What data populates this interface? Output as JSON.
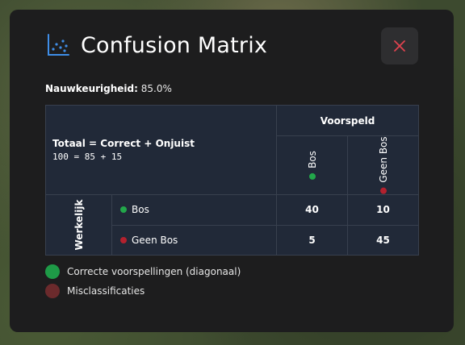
{
  "modal": {
    "title": "Confusion Matrix",
    "icon": "scatter-chart-icon",
    "close_icon": "close-icon"
  },
  "accuracy": {
    "label": "Nauwkeurigheid:",
    "value": "85.0%"
  },
  "matrix": {
    "total_label": "Totaal = Correct + Onjuist",
    "total_formula": "100 = 85 + 15",
    "predicted_header": "Voorspeld",
    "actual_header": "Werkelijk",
    "classes": [
      "Bos",
      "Geen Bos"
    ],
    "class_colors": [
      "#22a74a",
      "#b3212e"
    ],
    "rows": [
      {
        "label": "Bos",
        "values": [
          "40",
          "10"
        ]
      },
      {
        "label": "Geen Bos",
        "values": [
          "5",
          "45"
        ]
      }
    ]
  },
  "legend": [
    {
      "label": "Correcte voorspellingen (diagonaal)",
      "color": "#1e9a47"
    },
    {
      "label": "Misclassificaties",
      "color": "#6b2a2c"
    }
  ]
}
